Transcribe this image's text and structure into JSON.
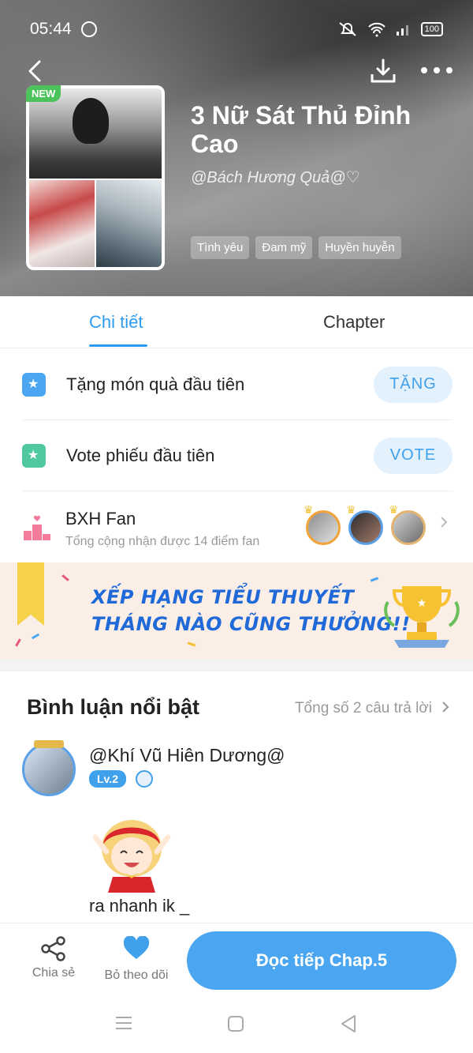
{
  "status_bar": {
    "time": "05:44",
    "battery": "100"
  },
  "header": {
    "badge": "NEW",
    "title": "3 Nữ Sát Thủ Đỉnh Cao",
    "author": "@Bách Hương Quả@♡",
    "tags": [
      "Tình yêu",
      "Đam mỹ",
      "Huyền huyễn"
    ]
  },
  "tabs": [
    "Chi tiết",
    "Chapter"
  ],
  "gift_row": {
    "label": "Tặng món quà đầu tiên",
    "button": "TẶNG",
    "icon": "gift-icon"
  },
  "vote_row": {
    "label": "Vote phiếu đầu tiên",
    "button": "VOTE",
    "icon": "ticket-icon"
  },
  "fan_row": {
    "title": "BXH Fan",
    "subtitle": "Tổng cộng nhận được 14 điểm fan",
    "icon": "podium-icon"
  },
  "banner": {
    "line1": "XẾP HẠNG TIỂU THUYẾT",
    "line2": "THÁNG NÀO CŨNG THƯỞNG!!"
  },
  "comments": {
    "heading": "Bình luận nổi bật",
    "total": "Tổng số 2 câu trả lời",
    "items": [
      {
        "user": "@Khí Vũ Hiên Dương@",
        "level": "Lv.2",
        "text": "ra nhanh ik _"
      }
    ]
  },
  "actions": {
    "share": "Chia sẻ",
    "unfollow": "Bỏ theo dõi",
    "read": "Đọc tiếp Chap.5"
  },
  "colors": {
    "accent": "#2d9cf0",
    "button_bg": "#4aa6f0",
    "badge_green": "#4cc25a"
  }
}
